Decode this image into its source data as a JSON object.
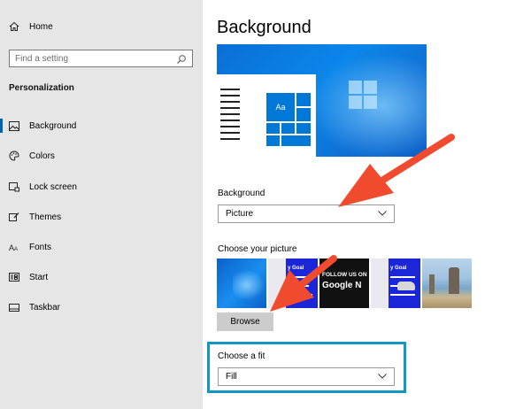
{
  "sidebar": {
    "home": "Home",
    "search_placeholder": "Find a setting",
    "section": "Personalization",
    "items": [
      {
        "label": "Background",
        "icon": "image-icon",
        "active": true
      },
      {
        "label": "Colors",
        "icon": "palette-icon"
      },
      {
        "label": "Lock screen",
        "icon": "lock-screen-icon"
      },
      {
        "label": "Themes",
        "icon": "themes-icon"
      },
      {
        "label": "Fonts",
        "icon": "fonts-icon"
      },
      {
        "label": "Start",
        "icon": "start-icon"
      },
      {
        "label": "Taskbar",
        "icon": "taskbar-icon"
      }
    ]
  },
  "main": {
    "title": "Background",
    "preview_tile_text": "Aa",
    "background_label": "Background",
    "background_value": "Picture",
    "choose_picture_label": "Choose your picture",
    "thumbnails": [
      {
        "texts": []
      },
      {
        "texts": [
          "y Goal",
          "— ",
          "— "
        ]
      },
      {
        "texts": [
          "FOLLOW US ON",
          "Google N"
        ]
      },
      {
        "texts": [
          "y Goal",
          "— ",
          "— "
        ]
      },
      {
        "texts": []
      }
    ],
    "browse_label": "Browse",
    "fit_label": "Choose a fit",
    "fit_value": "Fill"
  },
  "colors": {
    "accent": "#0063b1",
    "annotation_arrow": "#f04b2e",
    "highlight_box": "#1297c2"
  }
}
